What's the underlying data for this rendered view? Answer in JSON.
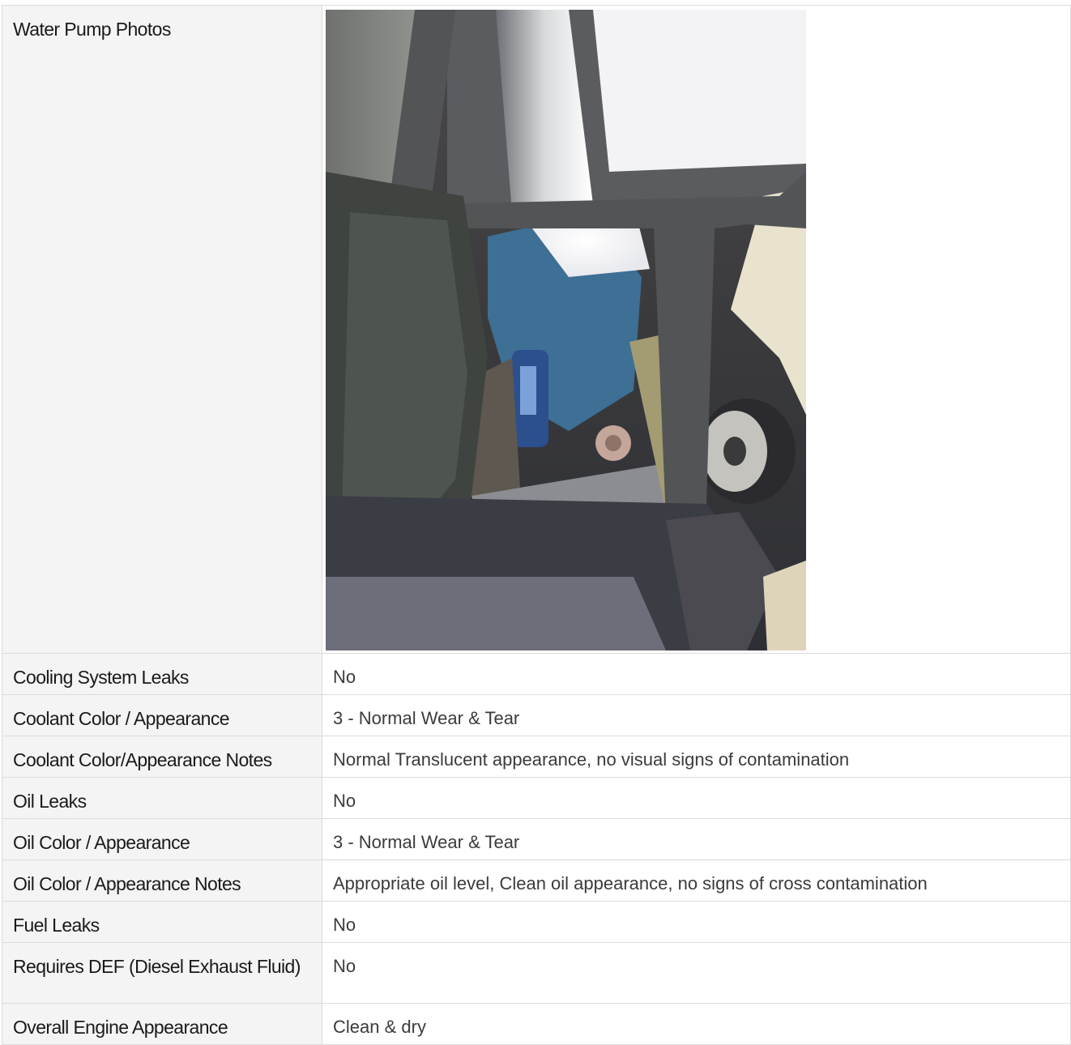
{
  "rows": [
    {
      "label": "Water Pump Photos",
      "value": "",
      "type": "photo",
      "photo_icon": "engine-water-pump-photo"
    },
    {
      "label": "Cooling System Leaks",
      "value": "No"
    },
    {
      "label": "Coolant Color / Appearance",
      "value": "3 - Normal Wear & Tear"
    },
    {
      "label": "Coolant Color/Appearance Notes",
      "value": "Normal Translucent appearance, no visual signs of contamination"
    },
    {
      "label": "Oil Leaks",
      "value": "No"
    },
    {
      "label": "Oil Color / Appearance",
      "value": "3 - Normal Wear & Tear"
    },
    {
      "label": "Oil Color / Appearance Notes",
      "value": "Appropriate oil level, Clean oil appearance, no signs of cross contamination"
    },
    {
      "label": "Fuel Leaks",
      "value": "No"
    },
    {
      "label": "Requires DEF (Diesel Exhaust Fluid)",
      "value": "No"
    },
    {
      "label": "Overall Engine Appearance",
      "value": "Clean & dry"
    }
  ]
}
